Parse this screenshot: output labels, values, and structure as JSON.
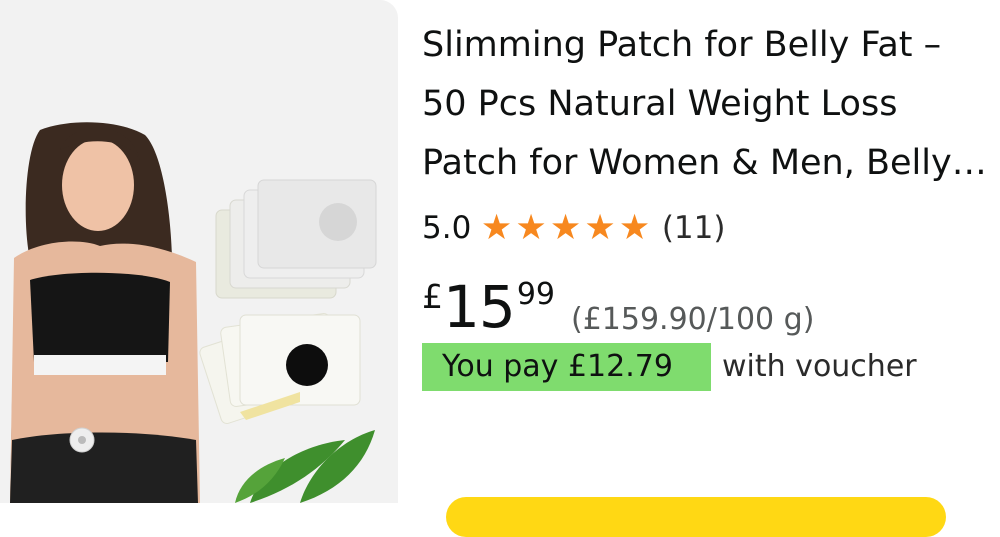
{
  "product": {
    "title": "Slimming Patch for Belly Fat – 50 Pcs Natural Weight Loss Patch for Women & Men, Belly Fat Burner Slimming Patches",
    "rating": {
      "value": "5.0",
      "stars": 5,
      "review_count": "(11)"
    },
    "price": {
      "currency": "£",
      "whole": "15",
      "fraction": "99",
      "unit_price": "(£159.90/100 g)"
    },
    "voucher": {
      "label": "You pay £12.79",
      "suffix": "with voucher"
    },
    "image_alt": "Slimming patch product image",
    "icons": {
      "star": "star-icon"
    }
  },
  "colors": {
    "star": "#f7881f",
    "voucher_bg": "#7fdc6e",
    "button": "#ffd814",
    "image_bg": "#f2f2f2"
  }
}
